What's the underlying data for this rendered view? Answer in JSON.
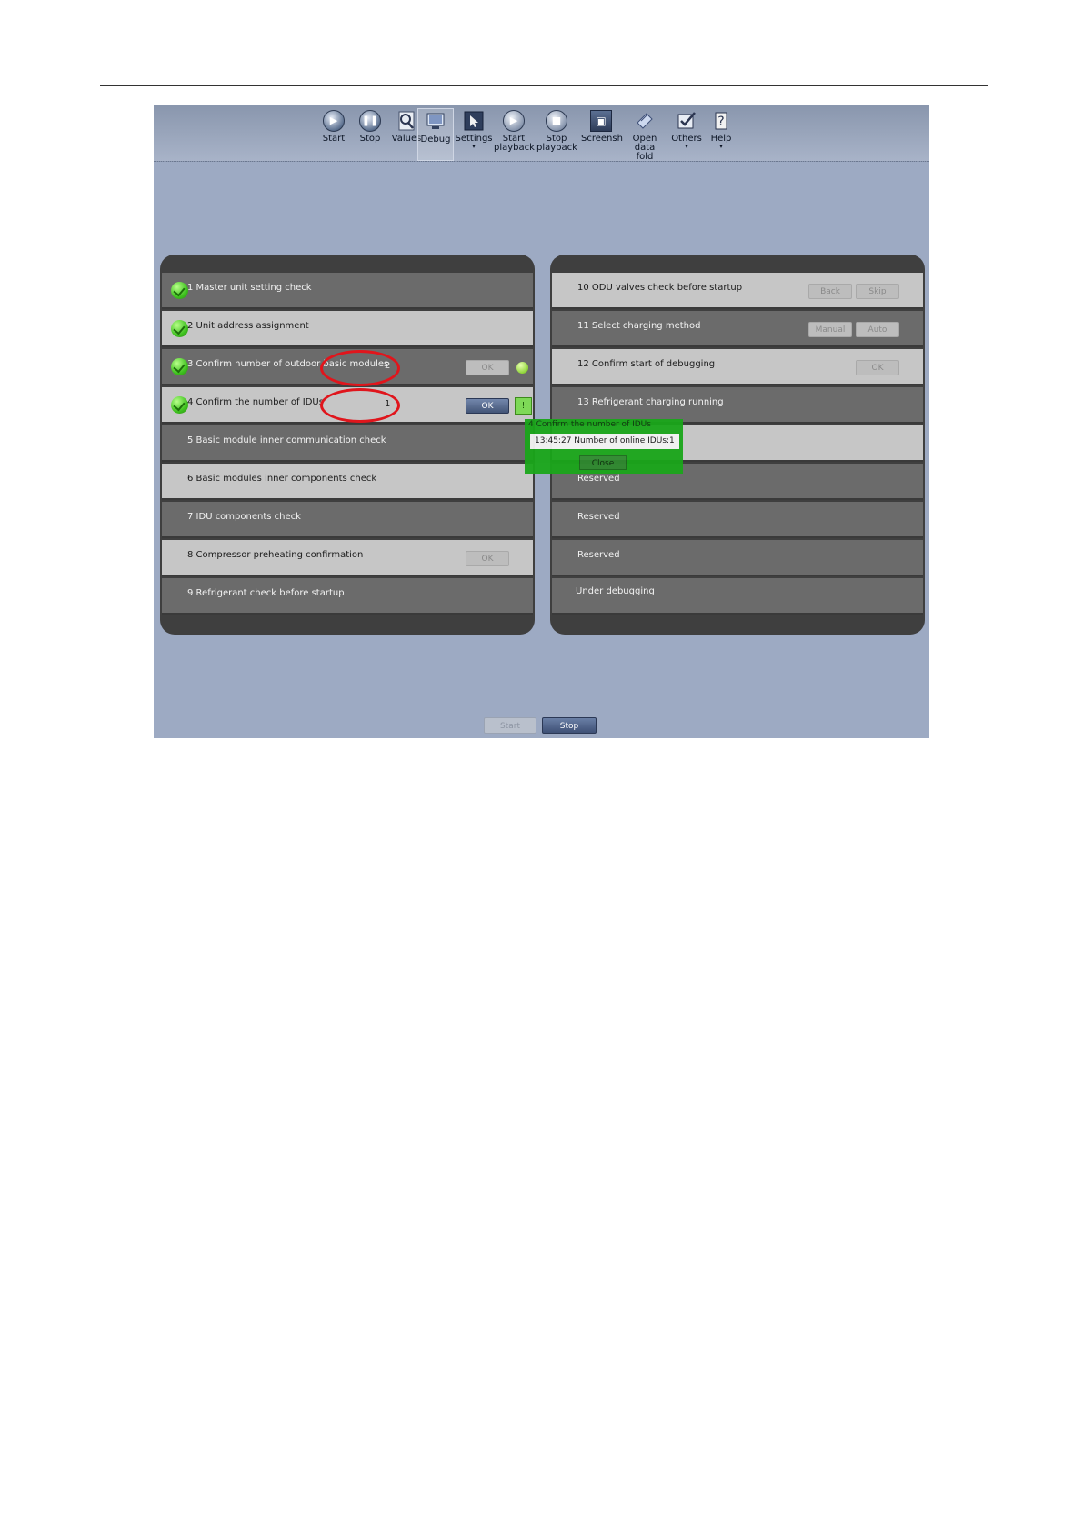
{
  "toolbar": {
    "items": [
      {
        "label": "Start",
        "icon": "play-icon"
      },
      {
        "label": "Stop",
        "icon": "pause-icon"
      },
      {
        "label": "Values",
        "icon": "magnifier-icon"
      },
      {
        "label": "Debug",
        "icon": "monitor-icon"
      },
      {
        "label": "Settings",
        "icon": "settings-icon"
      },
      {
        "label": "Start\nplayback",
        "icon": "playback-start-icon"
      },
      {
        "label": "Stop\nplayback",
        "icon": "playback-stop-icon"
      },
      {
        "label": "Screensh",
        "icon": "screenshot-icon"
      },
      {
        "label": "Open\ndata fold",
        "icon": "folder-icon"
      },
      {
        "label": "Others",
        "icon": "others-icon"
      },
      {
        "label": "Help",
        "icon": "help-icon"
      }
    ]
  },
  "left_panel": {
    "rows": [
      {
        "label": "1 Master unit setting check"
      },
      {
        "label": "2 Unit address assignment"
      },
      {
        "label": "3 Confirm number of outdoor basic modules",
        "value": "2",
        "button": "OK"
      },
      {
        "label": "4 Confirm the number of IDUs",
        "value": "1",
        "button": "OK",
        "indicator": "!"
      },
      {
        "label": "5 Basic module inner communication check"
      },
      {
        "label": "6 Basic modules inner components check"
      },
      {
        "label": "7 IDU components check"
      },
      {
        "label": "8 Compressor preheating confirmation",
        "button": "OK"
      },
      {
        "label": "9 Refrigerant check before startup"
      }
    ]
  },
  "right_panel": {
    "rows": [
      {
        "label": "10 ODU valves check before startup",
        "buttons": [
          "Back",
          "Skip"
        ]
      },
      {
        "label": "11 Select charging method",
        "buttons": [
          "Manual",
          "Auto"
        ]
      },
      {
        "label": "12 Confirm start of debugging",
        "buttons": [
          "OK"
        ]
      },
      {
        "label": "13 Refrigerant charging running"
      },
      {
        "label": ""
      },
      {
        "label": "Reserved"
      },
      {
        "label": "Reserved"
      },
      {
        "label": "Reserved"
      },
      {
        "label": "Under debugging"
      }
    ]
  },
  "popup": {
    "title": "4 Confirm the number of IDUs",
    "message": "13:45:27 Number of online IDUs:1",
    "close_label": "Close"
  },
  "bottom": {
    "start_label": "Start",
    "stop_label": "Stop"
  },
  "colors": {
    "highlight_ring": "#e0151c",
    "popup_bg": "#1aa61a",
    "complete_check": "#3fc21f"
  }
}
